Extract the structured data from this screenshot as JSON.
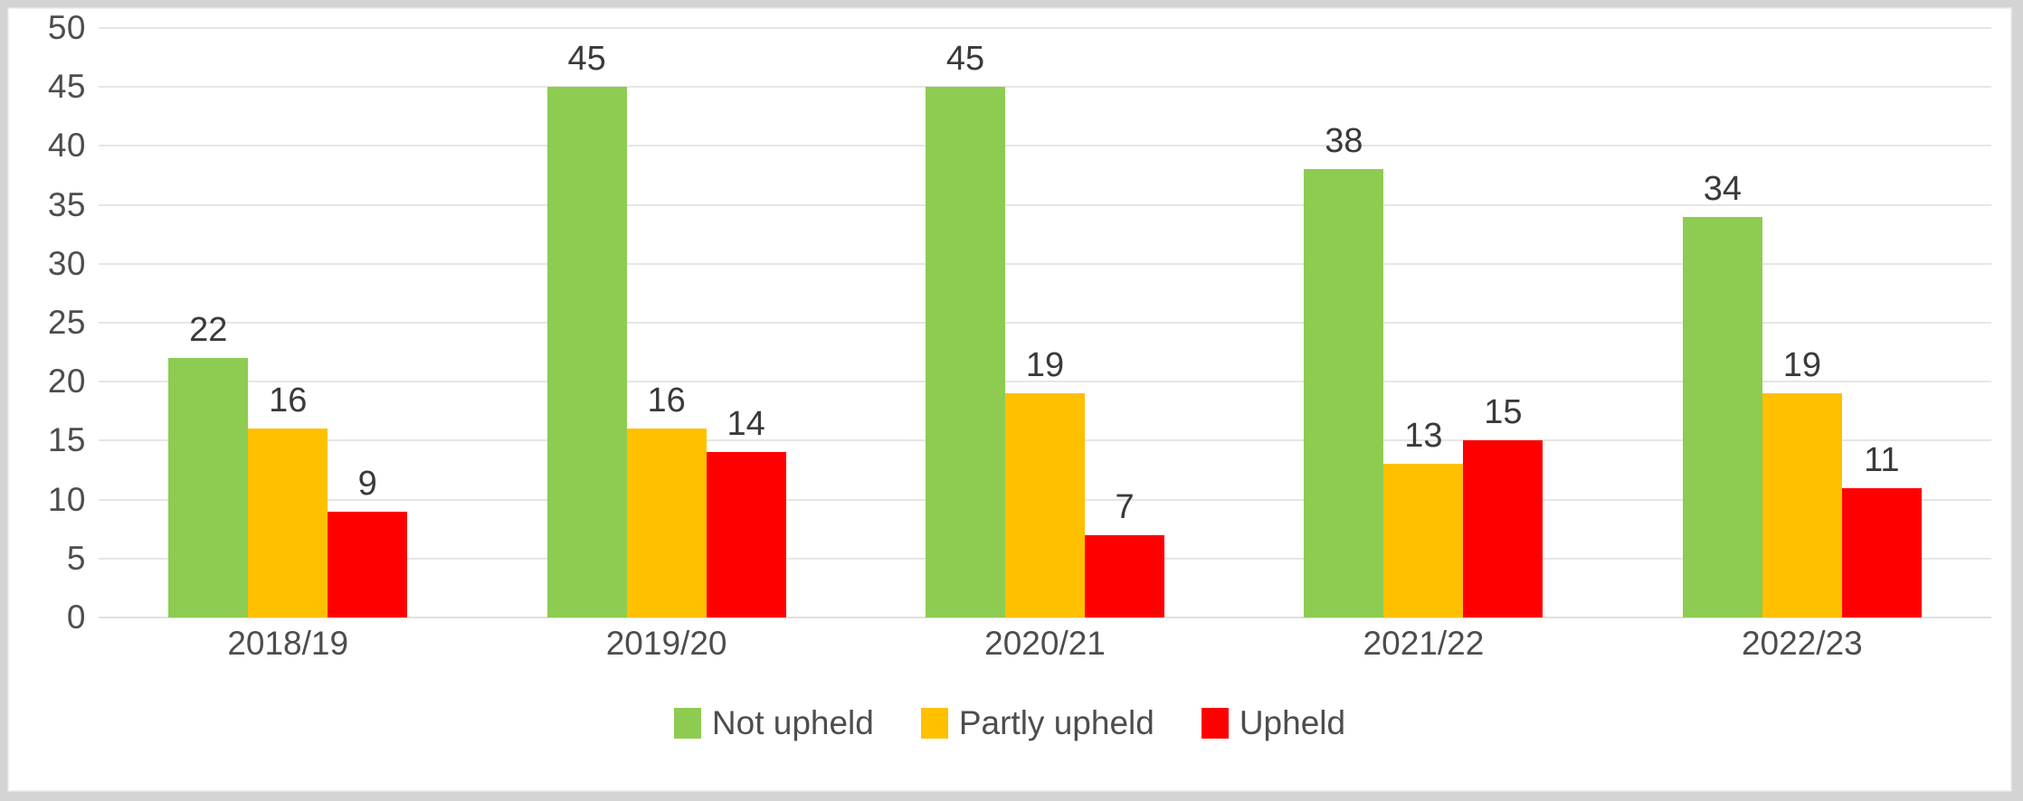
{
  "chart_data": {
    "type": "bar",
    "title": "",
    "subtitle": "",
    "xlabel": "",
    "ylabel": "",
    "categories": [
      "2018/19",
      "2019/20",
      "2020/21",
      "2021/22",
      "2022/23"
    ],
    "series": [
      {
        "name": "Not upheld",
        "color": "#8DCC51",
        "values": [
          22,
          45,
          45,
          38,
          34
        ]
      },
      {
        "name": "Partly upheld",
        "color": "#FFC000",
        "values": [
          16,
          16,
          19,
          13,
          19
        ]
      },
      {
        "name": "Upheld",
        "color": "#FF0000",
        "values": [
          9,
          14,
          7,
          15,
          11
        ]
      }
    ],
    "ylim": [
      0,
      50
    ],
    "ytick_step": 5,
    "yticks": [
      "0",
      "5",
      "10",
      "15",
      "20",
      "25",
      "30",
      "35",
      "40",
      "45",
      "50"
    ],
    "grid": true,
    "grid_axis": "y",
    "legend_position": "bottom",
    "data_labels": true,
    "bar_group_order": [
      "Not upheld",
      "Partly upheld",
      "Upheld"
    ]
  },
  "legend": {
    "items": [
      {
        "label": "Not upheld",
        "color": "#8DCC51"
      },
      {
        "label": "Partly upheld",
        "color": "#FFC000"
      },
      {
        "label": "Upheld",
        "color": "#FF0000"
      }
    ]
  },
  "colors": {
    "not_upheld": "#8DCC51",
    "partly_upheld": "#FFC000",
    "upheld": "#FF0000",
    "gridline": "#E6E6E6",
    "text": "#4D4D4D",
    "plot_background": "#FFFFFF",
    "page_background": "#D4D4D4"
  }
}
